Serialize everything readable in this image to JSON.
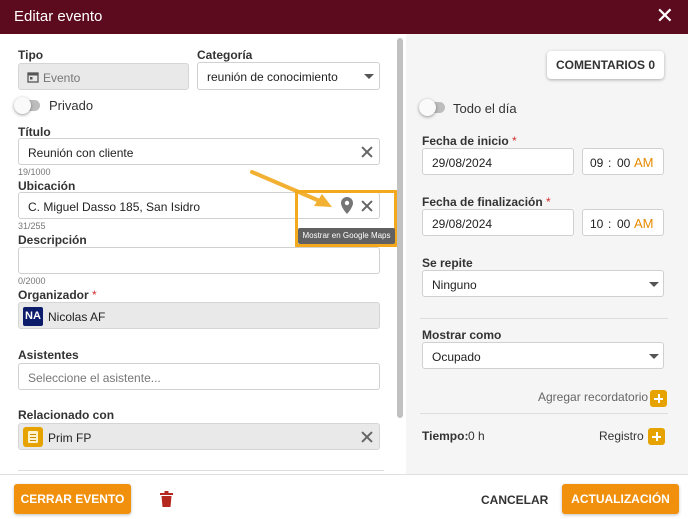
{
  "dialog": {
    "title": "Editar evento"
  },
  "tipo": {
    "label": "Tipo",
    "value": "Evento"
  },
  "categoria": {
    "label": "Categoría",
    "value": "reunión de conocimiento"
  },
  "privado": {
    "label": "Privado"
  },
  "titulo": {
    "label": "Título",
    "value": "Reunión con cliente",
    "counter": "19/1000"
  },
  "ubicacion": {
    "label": "Ubicación",
    "value": "C. Miguel Dasso 185, San Isidro",
    "counter": "31/255",
    "tooltip": "Mostrar en Google Maps"
  },
  "descripcion": {
    "label": "Descripción",
    "value": "",
    "counter": "0/2000"
  },
  "organizador": {
    "label": "Organizador",
    "required_mark": "*",
    "initials": "NA",
    "name": "Nicolas AF"
  },
  "asistentes": {
    "label": "Asistentes",
    "placeholder": "Seleccione el asistente..."
  },
  "relacionado": {
    "label": "Relacionado con",
    "value": "Prim FP"
  },
  "comentarios": {
    "label": "COMENTARIOS 0"
  },
  "todo_el_dia": {
    "label": "Todo el día"
  },
  "inicio": {
    "label": "Fecha de inicio",
    "required_mark": "*",
    "date": "29/08/2024",
    "hour": "09",
    "sep": ":",
    "minute": "00",
    "ampm": "AM"
  },
  "fin": {
    "label": "Fecha de finalización",
    "required_mark": "*",
    "date": "29/08/2024",
    "hour": "10",
    "sep": ":",
    "minute": "00",
    "ampm": "AM"
  },
  "repite": {
    "label": "Se repite",
    "value": "Ninguno"
  },
  "mostrar": {
    "label": "Mostrar como",
    "value": "Ocupado"
  },
  "recordatorio": {
    "label": "Agregar recordatorio"
  },
  "tiempo": {
    "label": "Tiempo:",
    "value": "0 h"
  },
  "registro": {
    "label": "Registro"
  },
  "footer": {
    "cerrar": "CERRAR EVENTO",
    "cancelar": "CANCELAR",
    "actualizar": "ACTUALIZACIÓN"
  },
  "colors": {
    "titlebar": "#5c0a1e",
    "accent": "#f0900c",
    "ampm": "#e68a00",
    "annotation": "#f2a91e"
  }
}
